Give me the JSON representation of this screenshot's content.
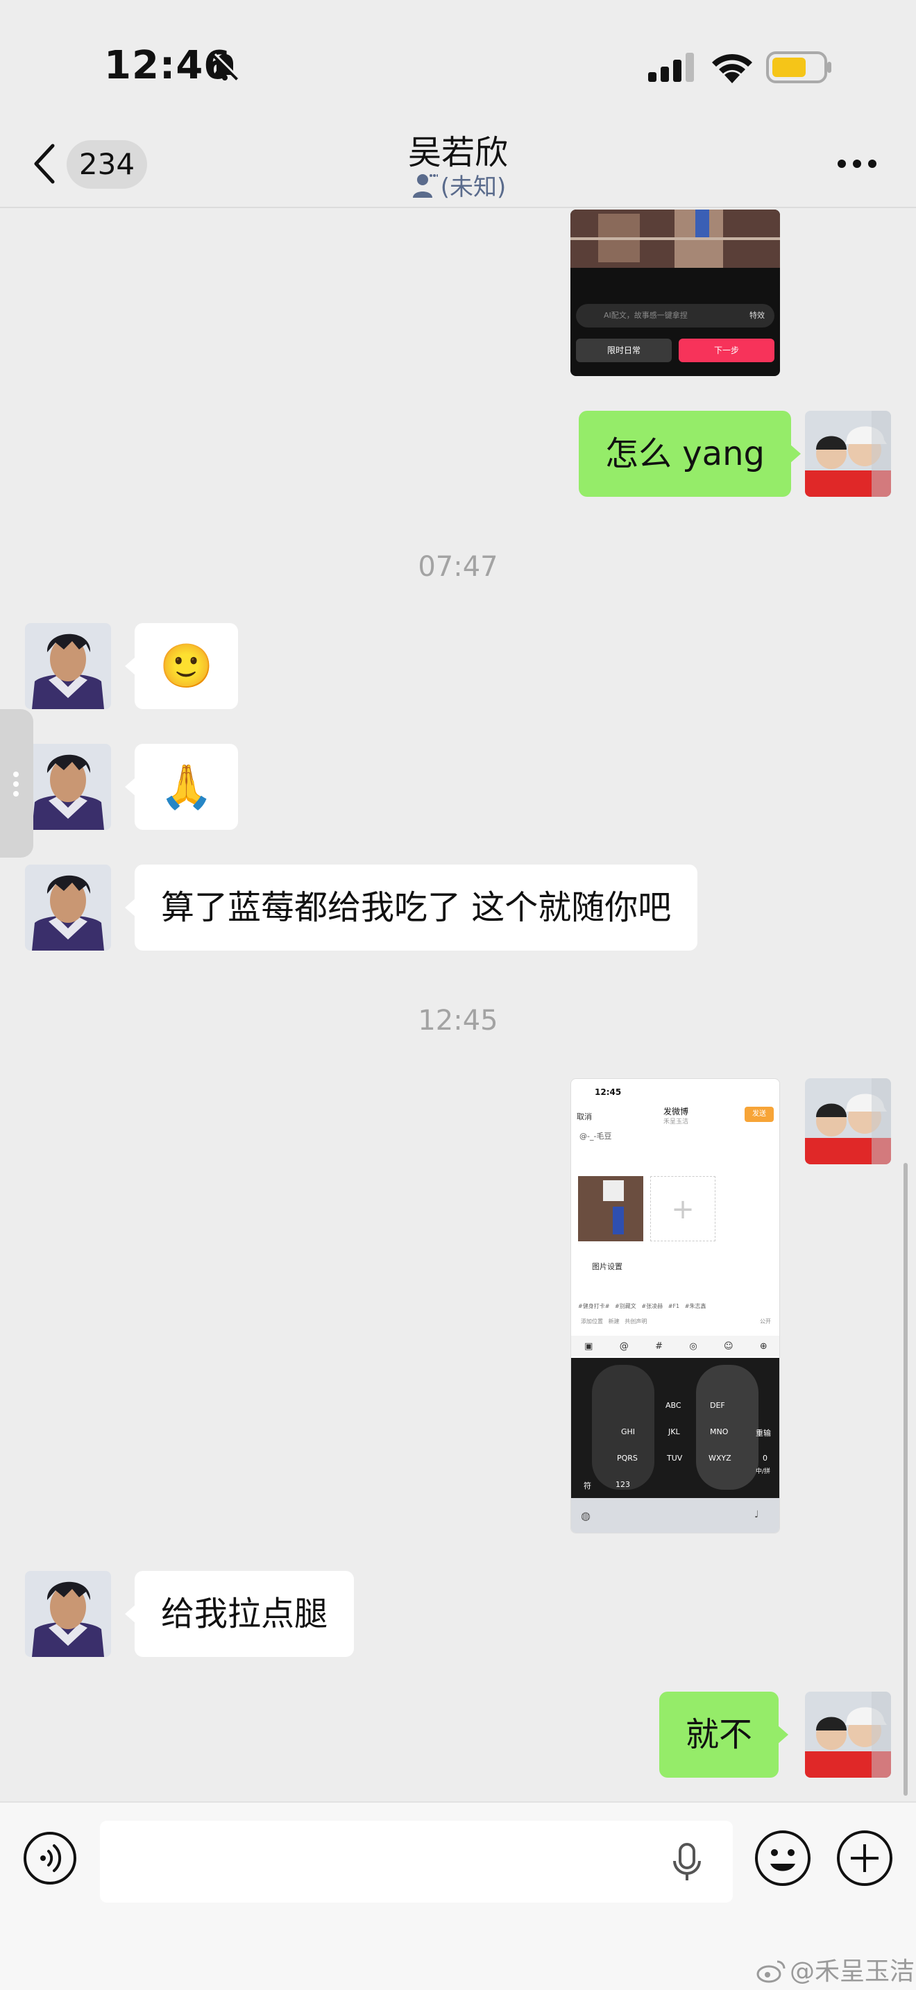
{
  "status_bar": {
    "time": "12:46"
  },
  "nav": {
    "badge": "234",
    "title": "吴若欣",
    "subtitle": "(未知)"
  },
  "messages": {
    "top_shot": {
      "caption_hint": "AI配文，故事感一键拿捏",
      "effects": "特效",
      "left_button": "限时日常",
      "right_button": "下一步"
    },
    "m1": "怎么 yang",
    "ts1": "07:47",
    "m2": "🙂",
    "m3": "🙏",
    "m4": "算了蓝莓都给我吃了 这个就随你吧",
    "ts2": "12:45",
    "shot2": {
      "time": "12:45",
      "cancel": "取消",
      "title": "发微博",
      "subtitle": "禾呈玉洁",
      "send": "发送",
      "text": "@-_-毛豆",
      "image_settings": "图片设置",
      "topics": [
        "#健身打卡#",
        "#别藏文",
        "#张凌赫",
        "#F1",
        "#朱志鑫"
      ],
      "options": [
        "添加位置",
        "新建",
        "共创声明",
        "公开"
      ],
      "keys": [
        "ABC",
        "DEF",
        "GHI",
        "JKL",
        "MNO",
        "PQRS",
        "TUV",
        "WXYZ",
        "符",
        "123",
        "0",
        "重输",
        "中/拼"
      ]
    },
    "m5": "给我拉点腿",
    "m6": "就不"
  },
  "input": {
    "placeholder": ""
  },
  "watermark": "@禾呈玉洁",
  "colors": {
    "bubble_out": "#95ec69",
    "bubble_in": "#ffffff",
    "background": "#ededed",
    "weibo_send": "#f7a437",
    "next_step": "#f7335a"
  }
}
